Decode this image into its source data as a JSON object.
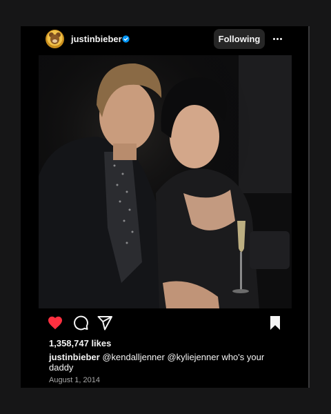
{
  "post": {
    "username": "justinbieber",
    "verified": true,
    "follow_label": "Following",
    "more_icon": "more-horizontal-icon",
    "photo": {
      "description": "Photo of two people posing together at a dimly lit event"
    },
    "actions": {
      "liked": true,
      "like_icon": "heart-filled-icon",
      "comment_icon": "comment-icon",
      "share_icon": "send-icon",
      "save_icon": "bookmark-filled-icon"
    },
    "likes_text": "1,358,747 likes",
    "caption": {
      "username": "justinbieber",
      "mention_1": "@kendalljenner",
      "mention_2": "@kyliejenner",
      "text": "who's your daddy"
    },
    "date": "August 1, 2014"
  },
  "colors": {
    "background": "#161617",
    "card": "#000000",
    "like_red": "#ff3040",
    "verified_blue": "#0095f6",
    "button_bg": "#262626",
    "muted_text": "#a8a8a8"
  }
}
